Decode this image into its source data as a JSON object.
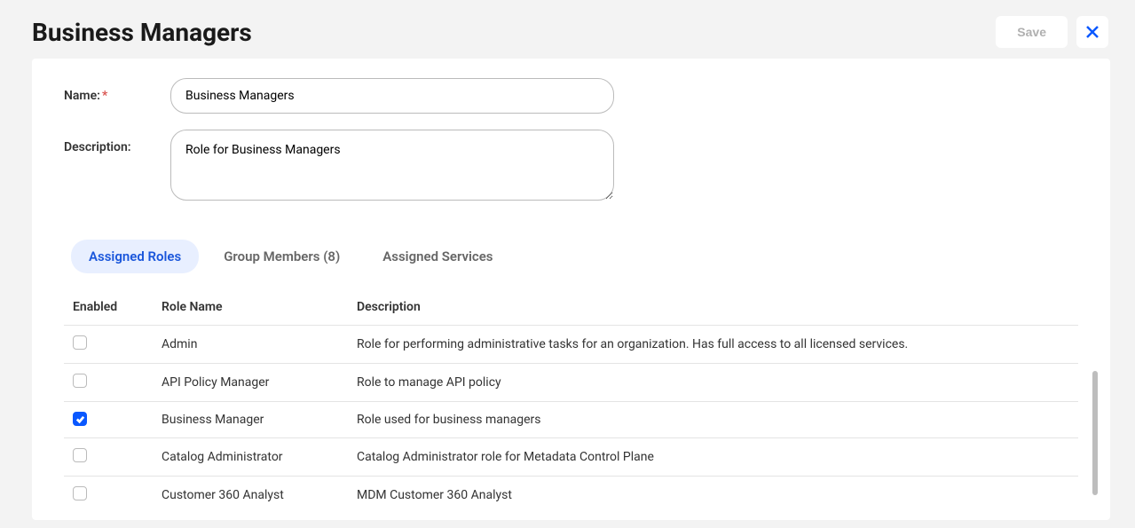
{
  "header": {
    "title": "Business Managers",
    "save_label": "Save"
  },
  "form": {
    "name_label": "Name:",
    "name_value": "Business Managers",
    "description_label": "Description:",
    "description_value": "Role for Business Managers"
  },
  "tabs": {
    "assigned_roles": "Assigned Roles",
    "group_members": "Group Members (8)",
    "assigned_services": "Assigned Services"
  },
  "table": {
    "columns": {
      "enabled": "Enabled",
      "role_name": "Role Name",
      "description": "Description"
    },
    "rows": [
      {
        "enabled": false,
        "role_name": "Admin",
        "description": "Role for performing administrative tasks for an organization. Has full access to all licensed services."
      },
      {
        "enabled": false,
        "role_name": "API Policy Manager",
        "description": "Role to manage API policy"
      },
      {
        "enabled": true,
        "role_name": "Business Manager",
        "description": "Role used for business managers"
      },
      {
        "enabled": false,
        "role_name": "Catalog Administrator",
        "description": "Catalog Administrator role for Metadata Control Plane"
      },
      {
        "enabled": false,
        "role_name": "Customer 360 Analyst",
        "description": "MDM Customer 360 Analyst"
      }
    ]
  }
}
